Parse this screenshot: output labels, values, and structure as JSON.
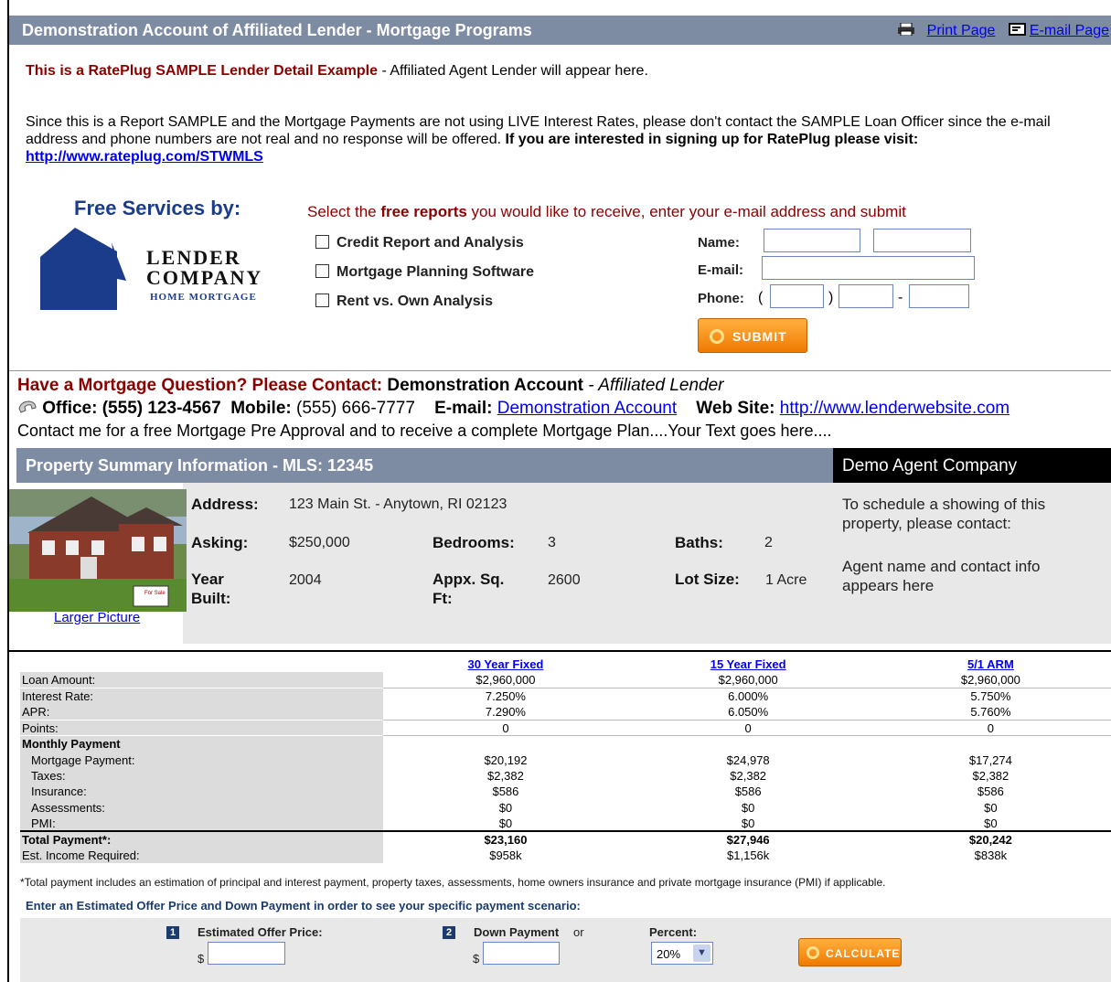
{
  "header": {
    "title": "Demonstration Account of Affiliated Lender - Mortgage Programs",
    "print_label": "Print Page",
    "email_label": "E-mail Page"
  },
  "sample": {
    "bold": "This is a RatePlug SAMPLE Lender Detail Example",
    "rest": " - Affiliated Agent Lender will appear here."
  },
  "notice": {
    "text": "Since this is a Report SAMPLE and the Mortgage Payments are not using LIVE Interest Rates, please don't contact the SAMPLE Loan Officer since the e-mail address and phone numbers are not real and no response will be offered. ",
    "bold": "If you are interested in signing up for RatePlug please visit: ",
    "link": "http://www.rateplug.com/STWMLS"
  },
  "services": {
    "title": "Free Services by:",
    "logo_line1": "LENDER",
    "logo_line2": "COMPANY",
    "logo_line3": "HOME MORTGAGE",
    "select_pre": "Select the ",
    "select_bold": "free reports",
    "select_post": " you would like to receive, enter your e-mail address and submit",
    "checkboxes": [
      "Credit Report and Analysis",
      "Mortgage Planning Software",
      "Rent vs. Own Analysis"
    ],
    "name_label": "Name:",
    "email_label": "E-mail:",
    "phone_label": "Phone:",
    "submit_label": "SUBMIT"
  },
  "contact": {
    "question": "Have a Mortgage Question?  Please Contact:",
    "name": " Demonstration Account",
    "role": " - Affiliated Lender",
    "office_label": "Office: (555) 123-4567",
    "mobile_label": "Mobile:",
    "mobile": " (555) 666-7777",
    "email_label": "E-mail:",
    "email_link": "Demonstration Account",
    "web_label": "Web Site:",
    "web_link": "http://www.lenderwebsite.com",
    "message": "Contact me for a free Mortgage Pre Approval and to receive a complete Mortgage Plan....Your Text goes here...."
  },
  "property": {
    "bar_title": "Property Summary Information - MLS: 12345",
    "agent_company": "Demo Agent Company",
    "larger_picture": "Larger Picture",
    "for_sale": "For Sale",
    "address_label": "Address:",
    "address": "123 Main St. - Anytown, RI 02123",
    "asking_label": "Asking:",
    "asking": "$250,000",
    "bedrooms_label": "Bedrooms:",
    "bedrooms": "3",
    "baths_label": "Baths:",
    "baths": "2",
    "year_label_1": "Year",
    "year_label_2": "Built:",
    "year": "2004",
    "sqft_label_1": "Appx. Sq.",
    "sqft_label_2": "Ft:",
    "sqft": "2600",
    "lot_label": "Lot Size:",
    "lot": "1 Acre",
    "agent_text_1": "To schedule a showing of this property, please contact:",
    "agent_text_2": "Agent name and contact info appears here"
  },
  "loans": {
    "programs": [
      "30 Year Fixed",
      "15 Year Fixed",
      "5/1 ARM"
    ],
    "rows": [
      {
        "label": "Loan Amount:",
        "values": [
          "$2,960,000",
          "$2,960,000",
          "$2,960,000"
        ]
      },
      {
        "label": "Interest Rate:",
        "values": [
          "7.250%",
          "6.000%",
          "5.750%"
        ]
      },
      {
        "label": "APR:",
        "values": [
          "7.290%",
          "6.050%",
          "5.760%"
        ]
      },
      {
        "label": "Points:",
        "values": [
          "0",
          "0",
          "0"
        ]
      },
      {
        "label": "Monthly Payment",
        "values": [
          "",
          "",
          ""
        ]
      },
      {
        "label": "Mortgage Payment:",
        "values": [
          "$20,192",
          "$24,978",
          "$17,274"
        ]
      },
      {
        "label": "Taxes:",
        "values": [
          "$2,382",
          "$2,382",
          "$2,382"
        ]
      },
      {
        "label": "Insurance:",
        "values": [
          "$586",
          "$586",
          "$586"
        ]
      },
      {
        "label": "Assessments:",
        "values": [
          "$0",
          "$0",
          "$0"
        ]
      },
      {
        "label": "PMI:",
        "values": [
          "$0",
          "$0",
          "$0"
        ]
      },
      {
        "label": "Total Payment*:",
        "values": [
          "$23,160",
          "$27,946",
          "$20,242"
        ]
      },
      {
        "label": "Est. Income Required:",
        "values": [
          "$958k",
          "$1,156k",
          "$838k"
        ]
      }
    ]
  },
  "footnote": "*Total payment includes an estimation of principal and interest payment, property taxes, assessments, home owners insurance and private mortgage insurance (PMI) if applicable.",
  "calculator": {
    "instruction": "Enter an Estimated Offer Price and Down Payment in order to see your specific payment scenario:",
    "step1_num": "1",
    "offer_label": "Estimated Offer Price:",
    "step2_num": "2",
    "down_label": "Down Payment",
    "or_label": "or",
    "percent_label": "Percent:",
    "currency": "$",
    "percent_value": "20%",
    "calculate_label": "CALCULATE"
  },
  "colors": {
    "header_bar": "#7d8ba3",
    "accent_red": "#8b0000",
    "button_orange": "#f07a00",
    "logo_blue": "#1b3b8b"
  }
}
